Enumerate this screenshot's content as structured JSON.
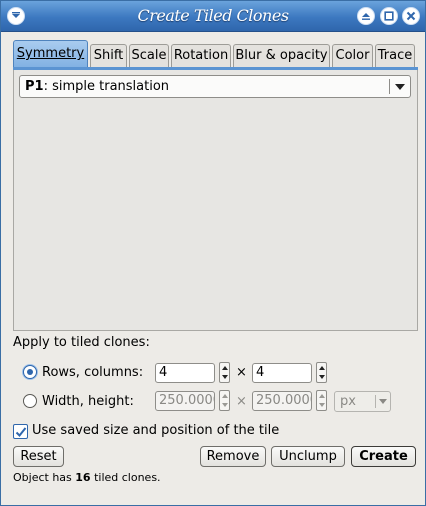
{
  "window": {
    "title": "Create Tiled Clones"
  },
  "tabs": [
    {
      "label": "Symmetry"
    },
    {
      "label": "Shift"
    },
    {
      "label": "Scale"
    },
    {
      "label": "Rotation"
    },
    {
      "label": "Blur & opacity"
    },
    {
      "label": "Color"
    },
    {
      "label": "Trace"
    }
  ],
  "symmetry": {
    "group_code": "P1",
    "group_name": ": simple translation"
  },
  "apply": {
    "label": "Apply to tiled clones:",
    "rows_columns_label": "Rows, columns:",
    "rows_value": "4",
    "columns_value": "4",
    "times": "×",
    "width_height_label": "Width, height:",
    "width_value": "250.0000",
    "height_value": "250.0000",
    "unit": "px",
    "selected_option": "rows_columns"
  },
  "use_saved": {
    "label": "Use saved size and position of the tile",
    "checked": true
  },
  "buttons": {
    "reset": "Reset",
    "remove": "Remove",
    "unclump": "Unclump",
    "create": "Create"
  },
  "status": {
    "prefix": "Object has ",
    "count": "16",
    "suffix": " tiled clones."
  },
  "colors": {
    "accent": "#2f66ac",
    "titlebar": "#3c78c0",
    "active_tab": "#8fbbe8"
  }
}
